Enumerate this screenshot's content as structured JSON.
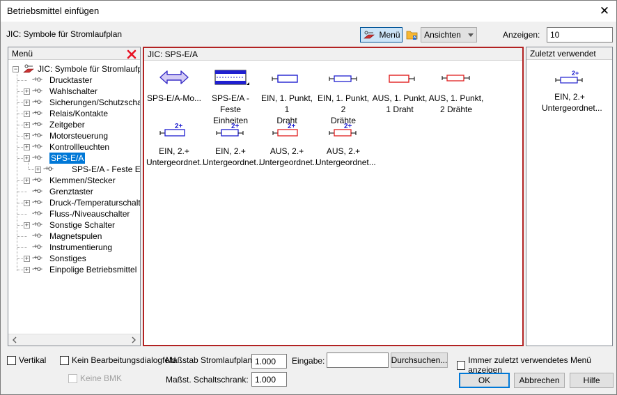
{
  "window": {
    "title": "Betriebsmittel einfügen",
    "close_glyph": "✕"
  },
  "toolbar": {
    "context_label": "JIC: Symbole für Stromlaufplan",
    "menu_button": "Menü",
    "views_button": "Ansichten",
    "show_label": "Anzeigen:",
    "show_value": "10"
  },
  "left_panel": {
    "header": "Menü",
    "root": "JIC: Symbole für Stromlaufplan",
    "items": [
      {
        "label": "Drucktaster",
        "expandable": false
      },
      {
        "label": "Wahlschalter",
        "expandable": true
      },
      {
        "label": "Sicherungen/Schutzschalt",
        "expandable": true
      },
      {
        "label": "Relais/Kontakte",
        "expandable": true
      },
      {
        "label": "Zeitgeber",
        "expandable": true
      },
      {
        "label": "Motorsteuerung",
        "expandable": true
      },
      {
        "label": "Kontrollleuchten",
        "expandable": true
      },
      {
        "label": "SPS-E/A",
        "expandable": true
      },
      {
        "label": "SPS-E/A - Feste Einhe",
        "expandable": true
      },
      {
        "label": "Klemmen/Stecker",
        "expandable": true
      },
      {
        "label": "Grenztaster",
        "expandable": false
      },
      {
        "label": "Druck-/Temperaturschalter",
        "expandable": true
      },
      {
        "label": "Fluss-/Niveauschalter",
        "expandable": false
      },
      {
        "label": "Sonstige Schalter",
        "expandable": true
      },
      {
        "label": "Magnetspulen",
        "expandable": false
      },
      {
        "label": "Instrumentierung",
        "expandable": false
      },
      {
        "label": "Sonstiges",
        "expandable": true
      },
      {
        "label": "Einpolige Betriebsmittel",
        "expandable": true
      }
    ]
  },
  "center_panel": {
    "header": "JIC: SPS-E/A",
    "symbols": [
      {
        "l1": "SPS-E/A-Mo...",
        "l2": ""
      },
      {
        "l1": "SPS-E/A - Feste",
        "l2": "Einheiten"
      },
      {
        "l1": "EIN, 1. Punkt, 1",
        "l2": "Draht"
      },
      {
        "l1": "EIN, 1. Punkt, 2",
        "l2": "Drähte"
      },
      {
        "l1": "AUS, 1. Punkt,",
        "l2": "1 Draht"
      },
      {
        "l1": "AUS, 1. Punkt,",
        "l2": "2 Drähte"
      },
      {
        "l1": "EIN, 2.+",
        "l2": "Untergeordnet..."
      },
      {
        "l1": "EIN, 2.+",
        "l2": "Untergeordnet..."
      },
      {
        "l1": "AUS, 2.+",
        "l2": "Untergeordnet..."
      },
      {
        "l1": "AUS, 2.+",
        "l2": "Untergeordnet..."
      }
    ],
    "badge": "2+"
  },
  "right_panel": {
    "header": "Zuletzt verwendet",
    "symbol": {
      "l1": "EIN, 2.+",
      "l2": "Untergeordnet..."
    }
  },
  "bottom": {
    "vertical": "Vertikal",
    "no_edit_dialog": "Kein Bearbeitungsdialogfeld",
    "no_bmk": "Keine BMK",
    "scale_label": "Maßstab Stromlaufplan:",
    "scale_value": "1.000",
    "cabinet_label": "Maßst. Schaltschrank:",
    "cabinet_value": "1.000",
    "input_label": "Eingabe:",
    "input_value": "",
    "browse": "Durchsuchen...",
    "always_last": "Immer zuletzt verwendetes Menü anzeigen",
    "ok": "OK",
    "cancel": "Abbrechen",
    "help": "Hilfe"
  },
  "colors": {
    "selection": "#0078d7",
    "highlight_border": "#b22222",
    "on_blue": "#1f1fd0",
    "off_red": "#e02020",
    "close_red": "#e81123"
  }
}
